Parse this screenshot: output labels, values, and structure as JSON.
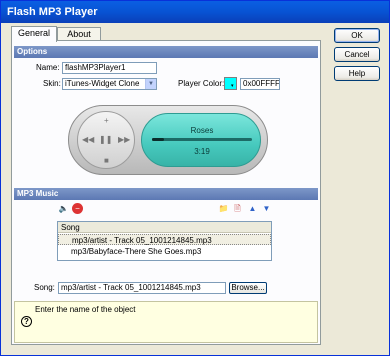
{
  "window": {
    "title": "Flash MP3 Player"
  },
  "tabs": [
    {
      "label": "General"
    },
    {
      "label": "About"
    }
  ],
  "options": {
    "header": "Options",
    "name_label": "Name:",
    "name_value": "flashMP3Player1",
    "skin_label": "Skin:",
    "skin_value": "iTunes-Widget Clone",
    "color_label": "Player Color:",
    "color_value": "0x00FFFF",
    "swatch_color": "#00ffff"
  },
  "player": {
    "song_title": "Roses",
    "time": "3:19",
    "progress": 0.12,
    "screen_color": "#46c9bd"
  },
  "mp3": {
    "header": "MP3 Music",
    "list_header": "Song",
    "songs": [
      "mp3/artist - Track 05_1001214845.mp3",
      "mp3/Babyface-There She Goes.mp3"
    ],
    "song_label": "Song:",
    "song_value": "mp3/artist - Track 05_1001214845.mp3",
    "browse_label": "Browse..."
  },
  "hint": {
    "text": "Enter the name of the object",
    "icon": "?"
  },
  "buttons": {
    "ok": "OK",
    "cancel": "Cancel",
    "help": "Help"
  }
}
